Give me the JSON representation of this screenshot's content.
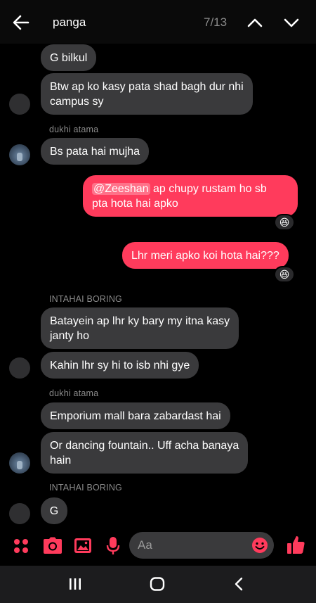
{
  "header": {
    "title": "panga",
    "counter": "7/13"
  },
  "messages": [
    {
      "text": "G bilkul"
    },
    {
      "text_l1": "Btw ap ko kasy pata shad bagh dur nhi",
      "text_l2": "campus sy"
    },
    {
      "sender": "dukhi atama"
    },
    {
      "text": "Bs pata hai mujha"
    },
    {
      "mention": "@Zeeshan",
      "text_l1": " ap chupy rustam ho sb",
      "text_l2": "pta hota hai apko",
      "reaction": "😆"
    },
    {
      "text": "Lhr meri apko koi hota hai???",
      "reaction": "😆"
    },
    {
      "sender": "INTAHAI BORING"
    },
    {
      "text_l1": "Batayein ap lhr ky bary my itna kasy",
      "text_l2": "janty ho"
    },
    {
      "text": "Kahin lhr sy hi to isb nhi gye"
    },
    {
      "sender": "dukhi atama"
    },
    {
      "text": "Emporium mall bara zabardast hai"
    },
    {
      "text_l1": "Or dancing fountain.. Uff acha banaya",
      "text_l2": "hain"
    },
    {
      "sender": "INTAHAI BORING"
    },
    {
      "text": "G"
    }
  ],
  "composer": {
    "placeholder": "Aa"
  },
  "colors": {
    "accent": "#ff3b5c",
    "bubble_received": "#3a3a3c",
    "background": "#000000"
  },
  "icons": [
    "back-arrow-icon",
    "chevron-up-icon",
    "chevron-down-icon",
    "menu-dots-icon",
    "camera-icon",
    "gallery-icon",
    "microphone-icon",
    "emoji-icon",
    "thumbs-up-icon",
    "recents-icon",
    "home-icon",
    "back-icon"
  ]
}
